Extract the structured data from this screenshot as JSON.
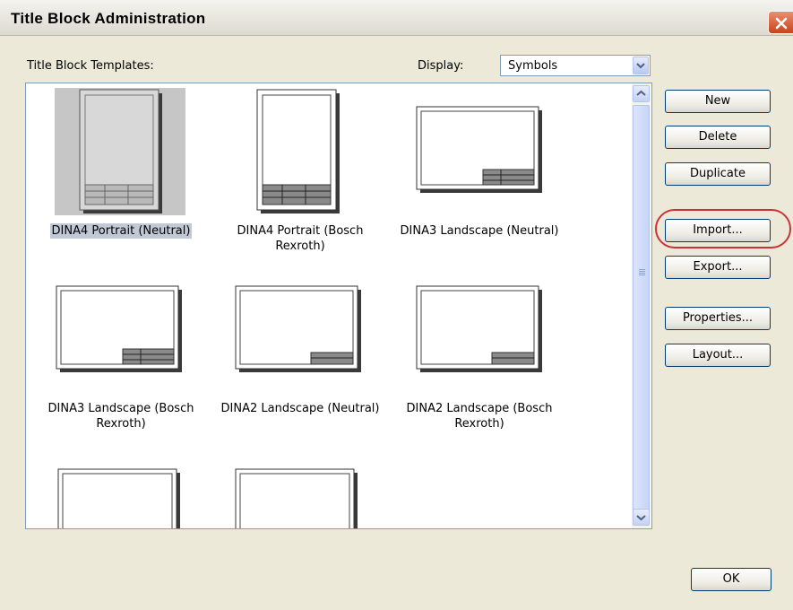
{
  "window": {
    "title": "Title Block Administration"
  },
  "templates_label": "Title Block Templates:",
  "display": {
    "label": "Display:",
    "value": "Symbols"
  },
  "templates": [
    {
      "name": "DINA4 Portrait (Neutral)",
      "orientation": "portrait",
      "selected": true
    },
    {
      "name": "DINA4 Portrait (Bosch Rexroth)",
      "orientation": "portrait",
      "selected": false
    },
    {
      "name": "DINA3 Landscape (Neutral)",
      "orientation": "landscape",
      "selected": false
    },
    {
      "name": "DINA3 Landscape (Bosch Rexroth)",
      "orientation": "landscape",
      "selected": false
    },
    {
      "name": "DINA2 Landscape (Neutral)",
      "orientation": "landscape",
      "selected": false
    },
    {
      "name": "DINA2 Landscape (Bosch Rexroth)",
      "orientation": "landscape",
      "selected": false
    }
  ],
  "buttons": {
    "new": "New",
    "delete": "Delete",
    "duplicate": "Duplicate",
    "import": "Import...",
    "export": "Export...",
    "properties": "Properties...",
    "layout": "Layout...",
    "ok": "OK"
  },
  "colors": {
    "selection": "#c2c9d6",
    "annotation": "#c8333a"
  },
  "icons": {
    "close": "close-icon",
    "dropdown": "chevron-down-icon",
    "scroll_up": "scroll-up-arrow-icon",
    "scroll_down": "scroll-down-arrow-icon"
  }
}
